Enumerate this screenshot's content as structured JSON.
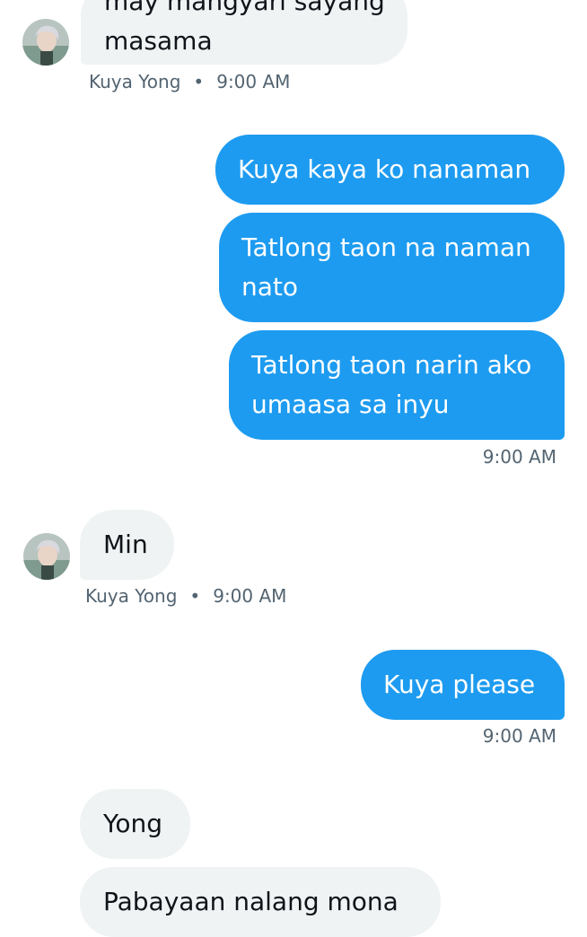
{
  "messages": [
    {
      "sender": "Kuya Yong",
      "direction": "in",
      "lines": [
        "may mangyari sayang",
        "masama"
      ]
    },
    {
      "direction": "out",
      "lines": [
        "Kuya kaya ko nanaman"
      ]
    },
    {
      "direction": "out",
      "lines": [
        "Tatlong taon na naman",
        "nato"
      ]
    },
    {
      "direction": "out",
      "lines": [
        "Tatlong taon narin ako",
        "umaasa sa inyu"
      ]
    },
    {
      "sender": "Kuya Yong",
      "direction": "in",
      "lines": [
        "Min"
      ]
    },
    {
      "direction": "out",
      "lines": [
        "Kuya please"
      ]
    },
    {
      "direction": "in",
      "lines": [
        "Yong"
      ]
    },
    {
      "direction": "in",
      "lines": [
        "Pabayaan nalang mona"
      ]
    }
  ],
  "meta": {
    "group1": {
      "sender": "Kuya Yong",
      "separator": "•",
      "time": "9:00 AM"
    },
    "group2": {
      "time": "9:00 AM"
    },
    "group3": {
      "sender": "Kuya Yong",
      "separator": "•",
      "time": "9:00 AM"
    },
    "group4": {
      "time": "9:00 AM"
    }
  },
  "colors": {
    "incoming_bubble": "#eff3f4",
    "outgoing_bubble": "#1d9bf0",
    "meta_text": "#536471"
  },
  "icons": {
    "avatar": "avatar-icon"
  }
}
